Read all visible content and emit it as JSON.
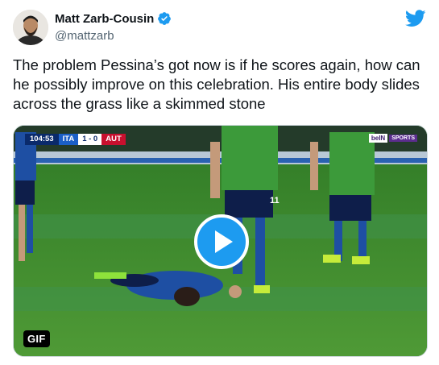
{
  "author": {
    "name": "Matt Zarb-Cousin",
    "handle": "@mattzarb",
    "verified": true
  },
  "tweet": {
    "text": "The problem Pessina’s got now is if he scores again, how can he possibly improve on this celebration. His entire body slides across the grass like a skimmed stone"
  },
  "media": {
    "type_badge": "GIF",
    "scoreboard": {
      "clock": "104:53",
      "home_team": "ITA",
      "score": "1 - 0",
      "away_team": "AUT"
    },
    "broadcaster": {
      "brand": "beIN",
      "channel": "SPORTS"
    },
    "shirt_number": "11"
  },
  "colors": {
    "accent": "#1d9bf0",
    "text_primary": "#0f1419",
    "text_secondary": "#536471",
    "pitch": "#3f8a2c"
  },
  "icons": {
    "brand": "twitter-bird-icon",
    "verified": "verified-badge-icon",
    "play": "play-icon"
  }
}
